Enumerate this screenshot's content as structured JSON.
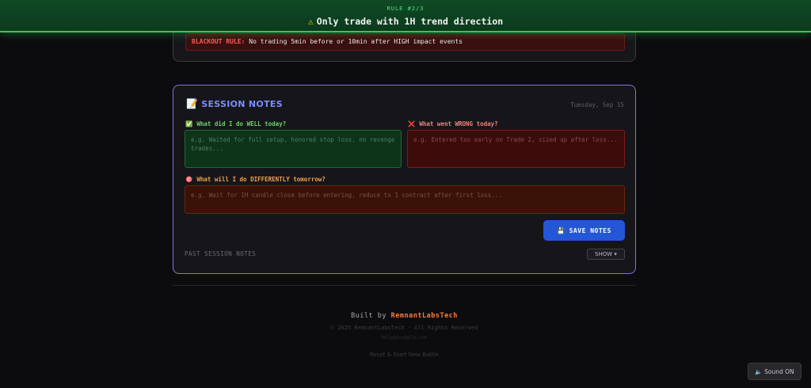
{
  "banner": {
    "rule_number": "RULE #2/3",
    "rule_text": "Only trade with 1H trend direction",
    "icon": "warning-icon"
  },
  "blackout": {
    "label": "BLACKOUT RULE:",
    "text": "No trading 5min before or 10min after HIGH impact events"
  },
  "session_notes": {
    "title": "SESSION NOTES",
    "icon": "memo-icon",
    "date": "Tuesday, Sep 15",
    "well": {
      "label": "What did I do WELL today?",
      "icon": "check-icon",
      "placeholder": "e.g. Waited for full setup, honored stop loss, no revenge trades..."
    },
    "wrong": {
      "label": "What went WRONG today?",
      "icon": "x-icon",
      "placeholder": "e.g. Entered too early on Trade 2, sized up after loss..."
    },
    "differently": {
      "label": "What will I do DIFFERENTLY tomorrow?",
      "icon": "target-icon",
      "placeholder": "e.g. Wait for 1H candle close before entering, reduce to 1 contract after first loss..."
    },
    "save_label": "SAVE NOTES",
    "past_label": "PAST SESSION NOTES",
    "show_label": "SHOW ▾"
  },
  "footer": {
    "built_by": "Built by",
    "brand": "RemnantLabsTech",
    "copyright": "© 2025 RemnantLabsTech · All Rights Reserved",
    "email": "help@example.com",
    "reset": "Reset & Start New Battle"
  },
  "sound": {
    "label": "Sound ON"
  },
  "colors": {
    "accent_green": "#2ecc54",
    "accent_purple": "#7f72e8",
    "save_blue": "#2456d8",
    "brand_orange": "#ff7a3a"
  }
}
